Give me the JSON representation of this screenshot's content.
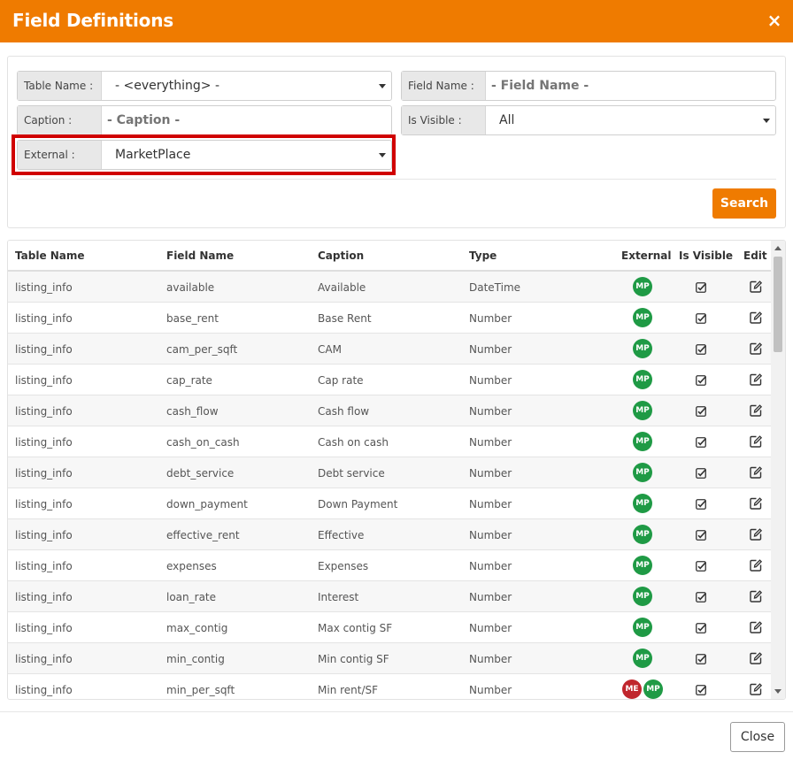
{
  "dialog": {
    "title": "Field Definitions",
    "close_glyph": "×",
    "close_button": "Close"
  },
  "filters": {
    "table_name": {
      "label": "Table Name :",
      "value": "- <everything> -"
    },
    "field_name": {
      "label": "Field Name :",
      "placeholder": "- Field Name -"
    },
    "caption": {
      "label": "Caption :",
      "placeholder": "- Caption -"
    },
    "is_visible": {
      "label": "Is Visible :",
      "value": "All"
    },
    "external": {
      "label": "External :",
      "value": "MarketPlace"
    },
    "search_button": "Search"
  },
  "table": {
    "headers": {
      "table_name": "Table Name",
      "field_name": "Field Name",
      "caption": "Caption",
      "type": "Type",
      "external": "External",
      "is_visible": "Is Visible",
      "edit": "Edit"
    },
    "rows": [
      {
        "table_name": "listing_info",
        "field_name": "available",
        "caption": "Available",
        "type": "DateTime",
        "external": [
          "MP"
        ]
      },
      {
        "table_name": "listing_info",
        "field_name": "base_rent",
        "caption": "Base Rent",
        "type": "Number",
        "external": [
          "MP"
        ]
      },
      {
        "table_name": "listing_info",
        "field_name": "cam_per_sqft",
        "caption": "CAM",
        "type": "Number",
        "external": [
          "MP"
        ]
      },
      {
        "table_name": "listing_info",
        "field_name": "cap_rate",
        "caption": "Cap rate",
        "type": "Number",
        "external": [
          "MP"
        ]
      },
      {
        "table_name": "listing_info",
        "field_name": "cash_flow",
        "caption": "Cash flow",
        "type": "Number",
        "external": [
          "MP"
        ]
      },
      {
        "table_name": "listing_info",
        "field_name": "cash_on_cash",
        "caption": "Cash on cash",
        "type": "Number",
        "external": [
          "MP"
        ]
      },
      {
        "table_name": "listing_info",
        "field_name": "debt_service",
        "caption": "Debt service",
        "type": "Number",
        "external": [
          "MP"
        ]
      },
      {
        "table_name": "listing_info",
        "field_name": "down_payment",
        "caption": "Down Payment",
        "type": "Number",
        "external": [
          "MP"
        ]
      },
      {
        "table_name": "listing_info",
        "field_name": "effective_rent",
        "caption": "Effective",
        "type": "Number",
        "external": [
          "MP"
        ]
      },
      {
        "table_name": "listing_info",
        "field_name": "expenses",
        "caption": "Expenses",
        "type": "Number",
        "external": [
          "MP"
        ]
      },
      {
        "table_name": "listing_info",
        "field_name": "loan_rate",
        "caption": "Interest",
        "type": "Number",
        "external": [
          "MP"
        ]
      },
      {
        "table_name": "listing_info",
        "field_name": "max_contig",
        "caption": "Max contig SF",
        "type": "Number",
        "external": [
          "MP"
        ]
      },
      {
        "table_name": "listing_info",
        "field_name": "min_contig",
        "caption": "Min contig SF",
        "type": "Number",
        "external": [
          "MP"
        ]
      },
      {
        "table_name": "listing_info",
        "field_name": "min_per_sqft",
        "caption": "Min rent/SF",
        "type": "Number",
        "external": [
          "ME",
          "MP"
        ]
      }
    ]
  },
  "icons": {
    "visible": "checkbox-checked-icon",
    "edit": "edit-square-icon"
  },
  "colors": {
    "accent": "#ef7b00",
    "mp_badge": "#1f9a45",
    "me_badge": "#c0262d",
    "highlight": "#d00000"
  }
}
